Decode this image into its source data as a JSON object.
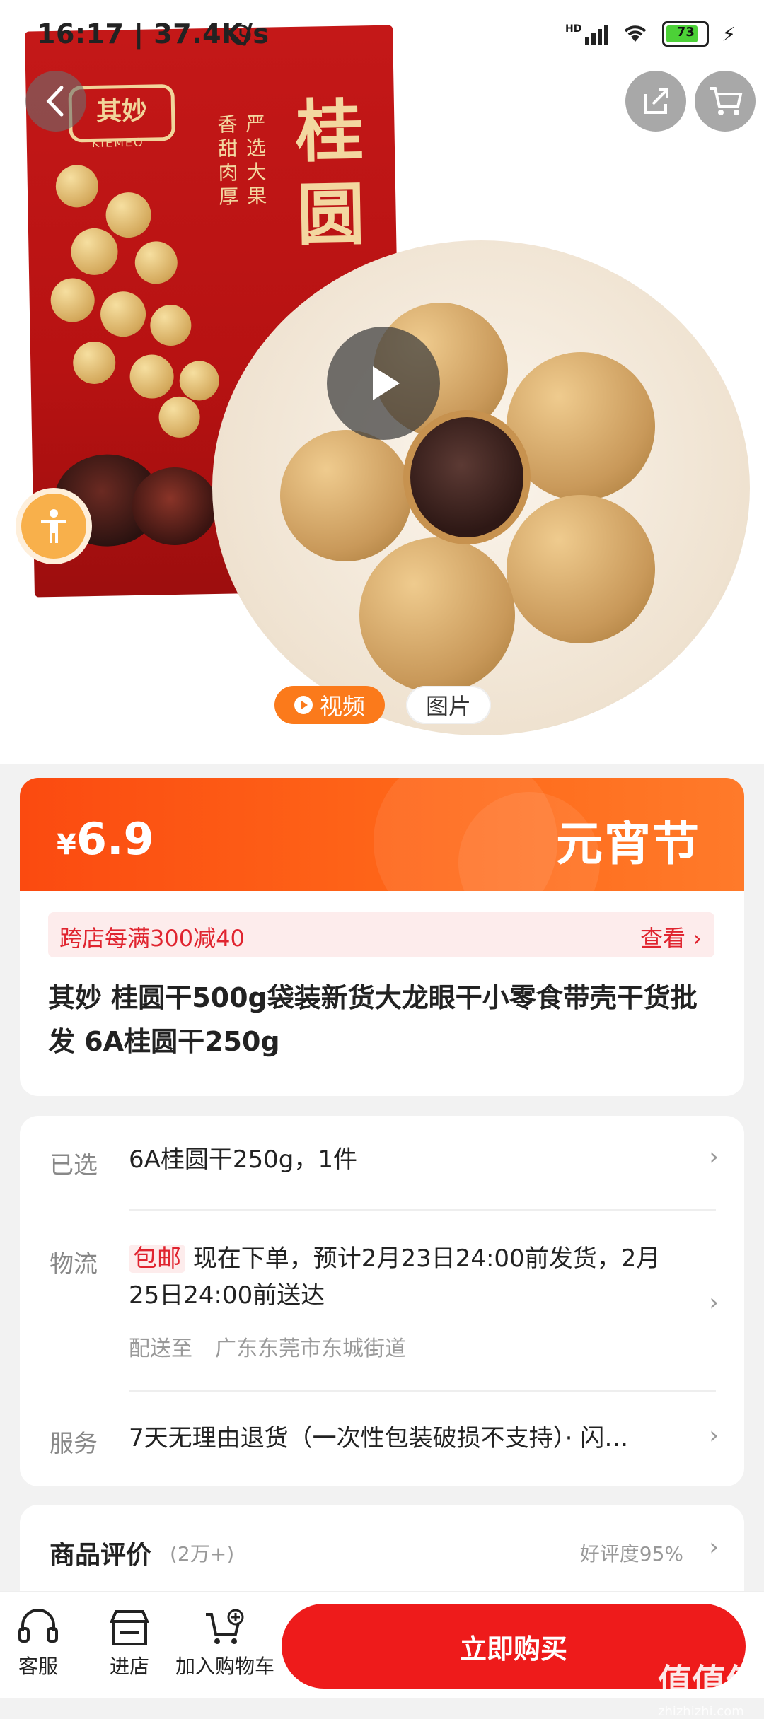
{
  "status_bar": {
    "time": "16:17 | 37.4K/s",
    "network": "HD",
    "battery": "73"
  },
  "hero": {
    "bag_brand": "其妙",
    "bag_brand_en": "KIEMEO",
    "bag_title": "桂圆",
    "bag_slogan_1": "严选大果",
    "bag_slogan_2": "香甜肉厚",
    "tabs": [
      {
        "label": "视频",
        "active": true
      },
      {
        "label": "图片",
        "active": false
      }
    ]
  },
  "price_card": {
    "currency": "¥",
    "price": "6.9",
    "festival": "元宵节",
    "promo_text": "跨店每满300减40",
    "promo_link": "查看 ›",
    "product_title": "其妙 桂圆干500g袋装新货大龙眼干小零食带壳干货批发 6A桂圆干250g"
  },
  "options": {
    "selected_label": "已选",
    "selected_value": "6A桂圆干250g，1件",
    "logistics_label": "物流",
    "free_shipping": "包邮",
    "logistics_value": "现在下单，预计2月23日24:00前发货，2月25日24:00前送达",
    "ship_to_label": "配送至",
    "ship_to_value": "广东东莞市东城街道",
    "service_label": "服务",
    "service_value": "7天无理由退货（一次性包装破损不支持）· 闪…"
  },
  "reviews": {
    "title": "商品评价",
    "count": "(2万+)",
    "rating": "好评度95%"
  },
  "bottom_bar": {
    "service": "客服",
    "store": "进店",
    "add_cart": "加入购物车",
    "buy_now": "立即购买",
    "watermark": "值值值",
    "watermark_sub": "zhizhizhi.com"
  },
  "colors": {
    "accent": "#fb4a10",
    "buy": "#ee1b1b",
    "promo_text": "#e0242f",
    "video_tab": "#fb7a1b"
  }
}
